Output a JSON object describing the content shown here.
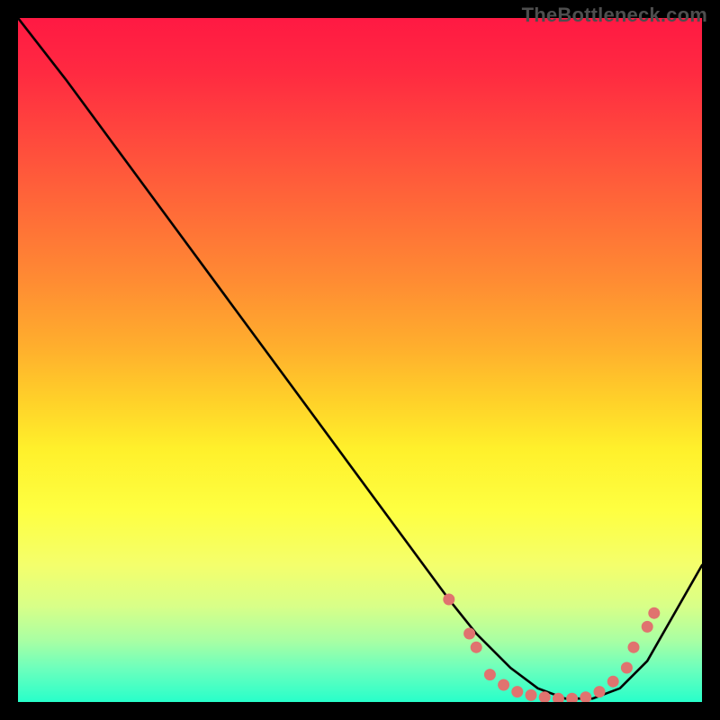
{
  "watermark": {
    "text": "TheBottleneck.com"
  },
  "chart_data": {
    "type": "line",
    "title": "",
    "xlabel": "",
    "ylabel": "",
    "xlim": [
      0,
      100
    ],
    "ylim": [
      0,
      100
    ],
    "series": [
      {
        "name": "bottleneck-curve",
        "x": [
          0,
          7,
          63,
          67,
          72,
          76,
          80,
          84,
          88,
          92,
          100
        ],
        "y": [
          100,
          91,
          15,
          10,
          5,
          2,
          0.5,
          0.5,
          2,
          6,
          20
        ]
      }
    ],
    "markers": {
      "name": "emphasis-dots",
      "color": "#e0736f",
      "points": [
        {
          "x": 63,
          "y": 15
        },
        {
          "x": 66,
          "y": 10
        },
        {
          "x": 67,
          "y": 8
        },
        {
          "x": 69,
          "y": 4
        },
        {
          "x": 71,
          "y": 2.5
        },
        {
          "x": 73,
          "y": 1.5
        },
        {
          "x": 75,
          "y": 1
        },
        {
          "x": 77,
          "y": 0.7
        },
        {
          "x": 79,
          "y": 0.5
        },
        {
          "x": 81,
          "y": 0.5
        },
        {
          "x": 83,
          "y": 0.7
        },
        {
          "x": 85,
          "y": 1.5
        },
        {
          "x": 87,
          "y": 3
        },
        {
          "x": 89,
          "y": 5
        },
        {
          "x": 90,
          "y": 8
        },
        {
          "x": 92,
          "y": 11
        },
        {
          "x": 93,
          "y": 13
        }
      ]
    },
    "gradient_stops": [
      {
        "pos": 0,
        "color": "#ff1943"
      },
      {
        "pos": 50,
        "color": "#ffb52d"
      },
      {
        "pos": 72,
        "color": "#feff41"
      },
      {
        "pos": 100,
        "color": "#28ffca"
      }
    ]
  }
}
